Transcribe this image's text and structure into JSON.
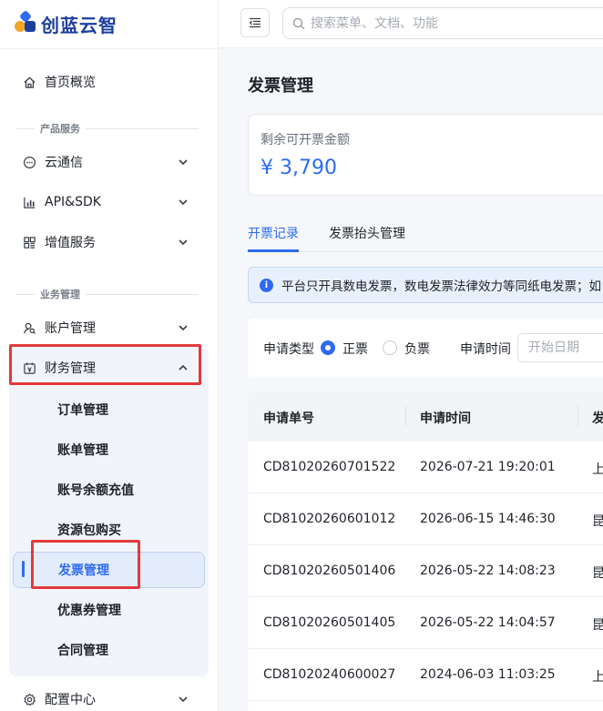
{
  "app": {
    "name": "创蓝云智"
  },
  "search": {
    "placeholder": "搜索菜单、文档、功能"
  },
  "sidebar": {
    "home": "首页概览",
    "group_product": "产品服务",
    "yuntongxin": "云通信",
    "api_sdk": "API&SDK",
    "value_added": "增值服务",
    "group_business": "业务管理",
    "account": "账户管理",
    "finance": "财务管理",
    "finance_children": [
      "订单管理",
      "账单管理",
      "账号余额充值",
      "资源包购买",
      "发票管理",
      "优惠券管理",
      "合同管理"
    ],
    "config": "配置中心"
  },
  "main": {
    "title": "发票管理",
    "balance_label": "剩余可开票金额",
    "balance_value": "¥ 3,790",
    "tabs": [
      "开票记录",
      "发票抬头管理"
    ],
    "notice": "平台只开具数电发票，数电发票法律效力等同纸电发票；如",
    "filter": {
      "type_label": "申请类型",
      "option_normal": "正票",
      "option_negative": "负票",
      "time_label": "申请时间",
      "start_placeholder": "开始日期"
    },
    "table": {
      "headers": [
        "申请单号",
        "申请时间",
        "发"
      ],
      "rows": [
        {
          "id": "CD81020260701522",
          "time": "2026-07-21 19:20:01",
          "c3": "上"
        },
        {
          "id": "CD81020260601012",
          "time": "2026-06-15 14:46:30",
          "c3": "昆"
        },
        {
          "id": "CD81020260501406",
          "time": "2026-05-22 14:08:23",
          "c3": "昆"
        },
        {
          "id": "CD81020260501405",
          "time": "2026-05-22 14:04:57",
          "c3": "昆"
        },
        {
          "id": "CD81020240600027",
          "time": "2024-06-03 11:03:25",
          "c3": "上"
        }
      ]
    }
  },
  "colors": {
    "accent": "#2f6bf2",
    "highlight": "#e4393c",
    "brand": "#1c3f9c"
  }
}
